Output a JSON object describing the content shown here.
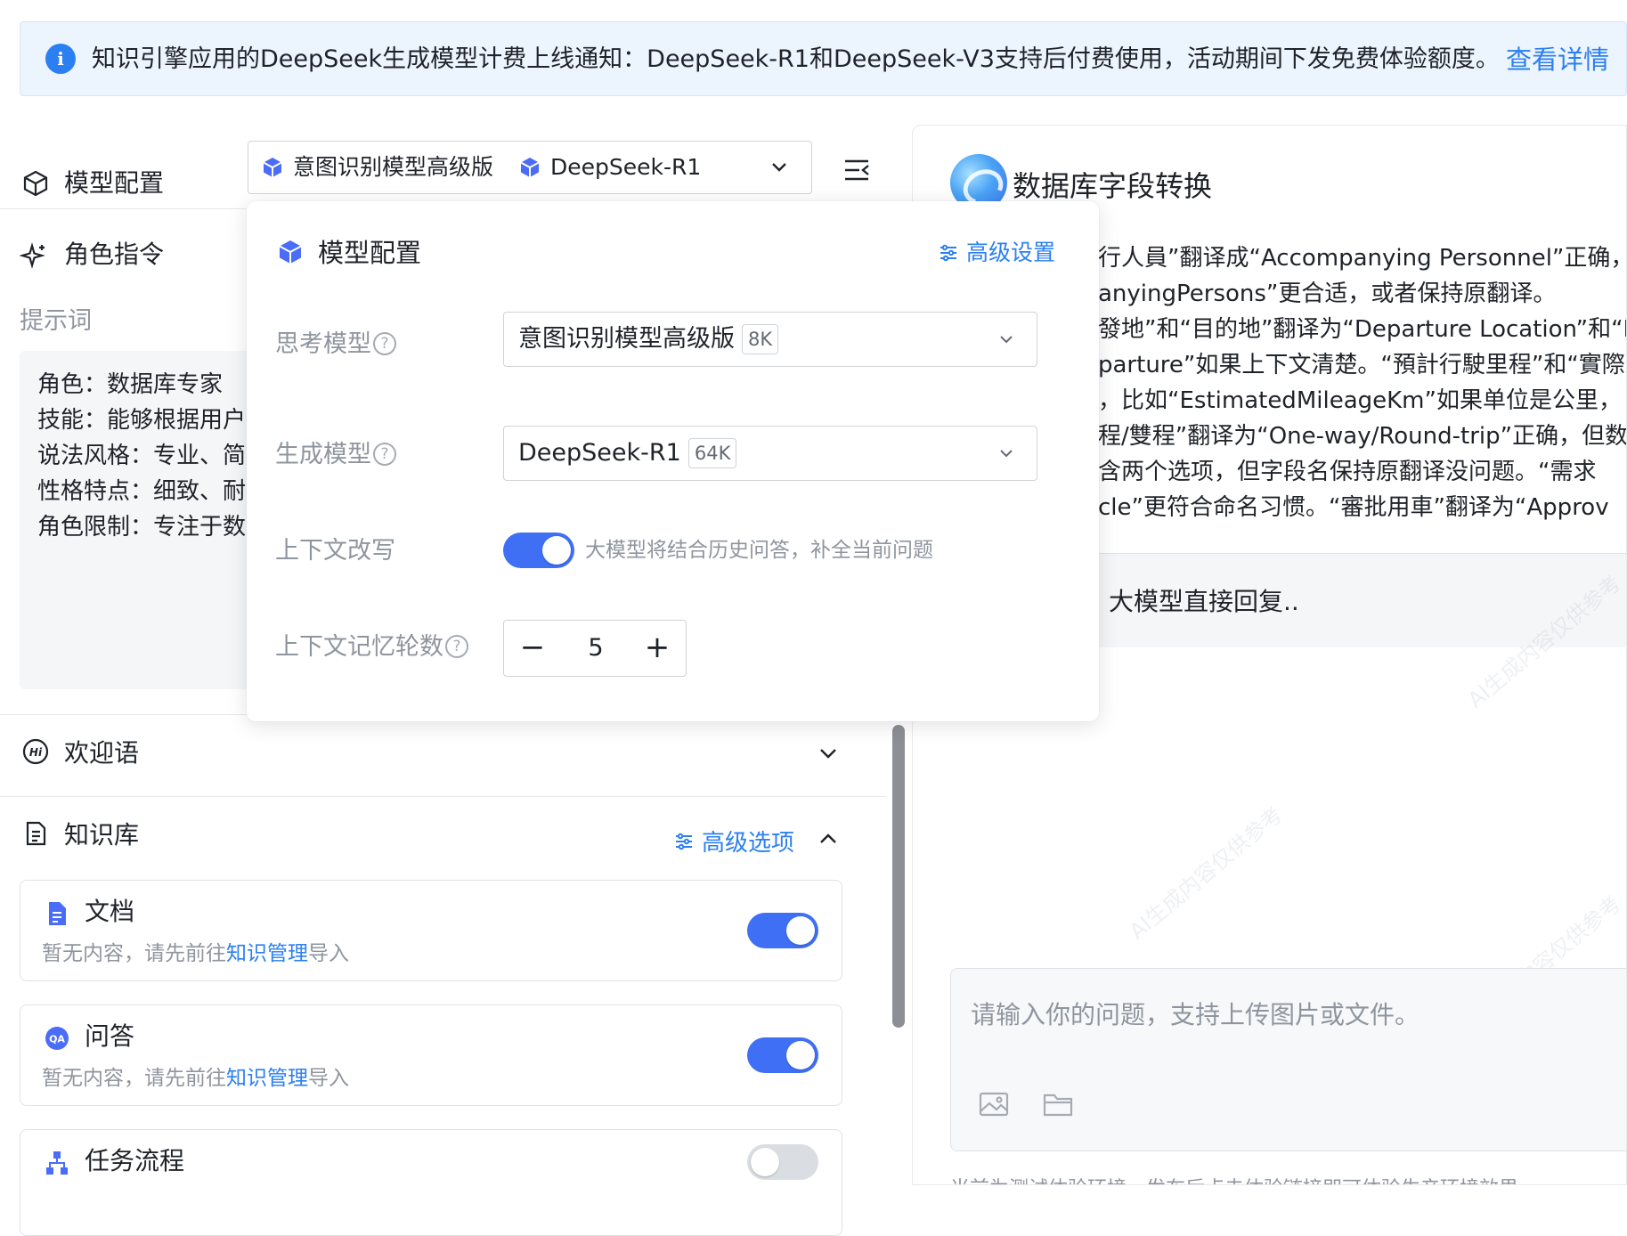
{
  "notice": {
    "message": "知识引擎应用的DeepSeek生成模型计费上线通知：DeepSeek-R1和DeepSeek-V3支持后付费使用，活动期间下发免费体验额度。",
    "link": "查看详情"
  },
  "left": {
    "model_config": {
      "title": "模型配置",
      "selected_think": "意图识别模型高级版",
      "selected_gen": "DeepSeek-R1"
    },
    "role": {
      "title": "角色指令",
      "prompt_label": "提示词",
      "lines": [
        "角色：数据库专家",
        "技能：能够根据用户",
        "说法风格：专业、简",
        "性格特点：细致、耐",
        "角色限制：专注于数"
      ]
    },
    "welcome": {
      "title": "欢迎语"
    },
    "kb": {
      "title": "知识库",
      "advanced": "高级选项",
      "cards": [
        {
          "title": "文档",
          "sub_pre": "暂无内容，请先前往",
          "sub_link": "知识管理",
          "sub_post": "导入",
          "enabled": true
        },
        {
          "title": "问答",
          "sub_pre": "暂无内容，请先前往",
          "sub_link": "知识管理",
          "sub_post": "导入",
          "enabled": true
        },
        {
          "title": "任务流程",
          "enabled": false
        }
      ]
    }
  },
  "popover": {
    "title": "模型配置",
    "advanced": "高级设置",
    "think_label": "思考模型",
    "think_value": "意图识别模型高级版",
    "think_tag": "8K",
    "gen_label": "生成模型",
    "gen_value": "DeepSeek-R1",
    "gen_tag": "64K",
    "rewrite_label": "上下文改写",
    "rewrite_desc": "大模型将结合历史问答，补全当前问题",
    "rewrite_on": true,
    "memory_label": "上下文记忆轮数",
    "memory_value": "5"
  },
  "right": {
    "app_title": "数据库字段转换",
    "chat_lines": [
      "行人員”翻译成“Accompanying Personnel”正确，但",
      "anyingPersons”更合适，或者保持原翻译。",
      "發地”和“目的地”翻译为“Departure Location”和“D",
      "parture”如果上下文清楚。“預計行駛里程”和“實際",
      "，比如“EstimatedMileageKm”如果单位是公里，",
      "程/雙程”翻译为“One-way/Round-trip”正确，但数",
      "含两个选项，但字段名保持原翻译没问题。“需求",
      "cle”更符合命名习惯。“審批用車”翻译为“Approv"
    ],
    "reply": "大模型直接回复..",
    "watermark": "AI生成内容仅供参考",
    "input_placeholder": "请输入你的问题，支持上传图片或文件。",
    "footer": "当前为测试体验环境，发布后点击体验链接即可体验生产环境效果"
  },
  "colors": {
    "accent": "#2c7ff0",
    "toggle_on": "#3f6ff4",
    "notice_bg": "#ecf4fd"
  }
}
